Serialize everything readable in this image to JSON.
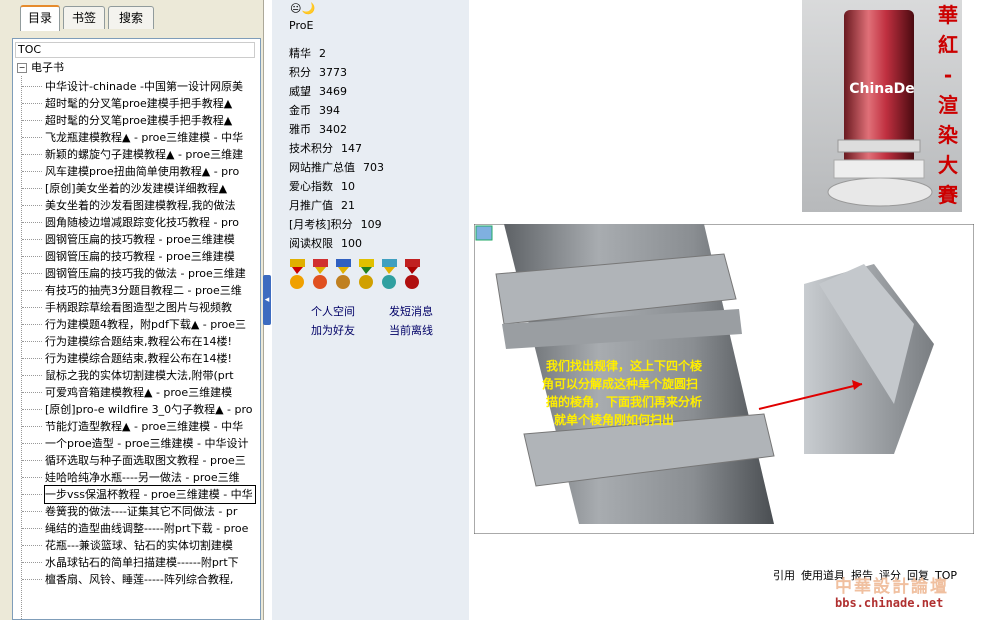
{
  "tabs": [
    "目录",
    "书签",
    "搜索"
  ],
  "tree": {
    "search_value": "TOC",
    "root_label": "电子书",
    "items": [
      "中华设计-chinade -中国第一设计网原美",
      "超时髦的分叉笔proe建模手把手教程▲",
      "超时髦的分叉笔proe建模手把手教程▲",
      "飞龙瓶建模教程▲ - proe三维建模 - 中华",
      "新颖的螺旋勺子建模教程▲ - proe三维建",
      "风车建模proe扭曲简单使用教程▲ - pro",
      "[原创]美女坐着的沙发建模详细教程▲",
      "美女坐着的沙发看图建模教程,我的做法",
      "圆角随棱边增减跟踪变化技巧教程 - pro",
      "圆钢管压扁的技巧教程 - proe三维建模",
      "圆钢管压扁的技巧教程 - proe三维建模",
      "圆钢管压扁的技巧我的做法 - proe三维建",
      "有技巧的抽壳3分题目教程二 - proe三维",
      "手柄跟踪草绘看图造型之图片与视频教",
      "行为建模题4教程，附pdf下载▲ - proe三",
      "行为建模综合题结束,教程公布在14楼!",
      "行为建模综合题结束,教程公布在14楼!",
      "鼠标之我的实体切割建模大法,附带(prt",
      "可爱鸡音箱建模教程▲ - proe三维建模",
      "[原创]pro-e wildfire 3_0勺子教程▲ - pro",
      "节能灯造型教程▲ - proe三维建模 - 中华",
      "一个proe造型 - proe三维建模 - 中华设计",
      "循环选取与种子面选取图文教程 - proe三",
      "娃哈哈纯净水瓶----另一做法 - proe三维",
      "一步vss保温杯教程 - proe三维建模 - 中华",
      "卷簧我的做法----证集其它不同做法 - pr",
      "绳结的造型曲线调整-----附prt下载 - proe",
      "花瓶---兼谈篮球、钻石的实体切割建模",
      "水晶球钻石的简单扫描建模------附prt下",
      "檀香扇、风铃、睡莲-----阵列综合教程,"
    ],
    "selected_index": 24
  },
  "user": {
    "emoticons": "😐🌙",
    "name": "ProE",
    "stats": [
      {
        "label": "精华",
        "value": "2"
      },
      {
        "label": "积分",
        "value": "3773"
      },
      {
        "label": "威望",
        "value": "3469"
      },
      {
        "label": "金币",
        "value": "394"
      },
      {
        "label": "雅币",
        "value": "3402"
      },
      {
        "label": "技术积分",
        "value": "147"
      },
      {
        "label": "网站推广总值",
        "value": "703"
      },
      {
        "label": "爱心指数",
        "value": "10"
      },
      {
        "label": "月推广值",
        "value": "21"
      },
      {
        "label": "[月考核]积分",
        "value": "109"
      },
      {
        "label": "阅读权限",
        "value": "100"
      }
    ],
    "links": [
      "个人空间",
      "发短消息",
      "加为好友",
      "当前离线"
    ]
  },
  "banner": {
    "logo_text": "ChinaDe",
    "vertical_text": [
      "華",
      "紅",
      "-",
      "渲",
      "染",
      "大",
      "賽"
    ]
  },
  "picture": {
    "caption_lines": [
      "我们找出规律，这上下四个棱",
      "角可以分解成这种单个旋圆扫",
      "描的棱角，下面我们再来分析",
      "就单个棱角刚如何扫出"
    ]
  },
  "post_actions": [
    "引用",
    "使用道具",
    "报告",
    "评分",
    "回复",
    "TOP"
  ],
  "watermark": {
    "title": "中華設計論壇",
    "url": "bbs.chinade.net"
  },
  "colors": {
    "banner_red": "#cc0000",
    "link_blue": "#000066",
    "sidebar_bg": "#e8edf3",
    "caption_yellow": "#ffee00"
  }
}
